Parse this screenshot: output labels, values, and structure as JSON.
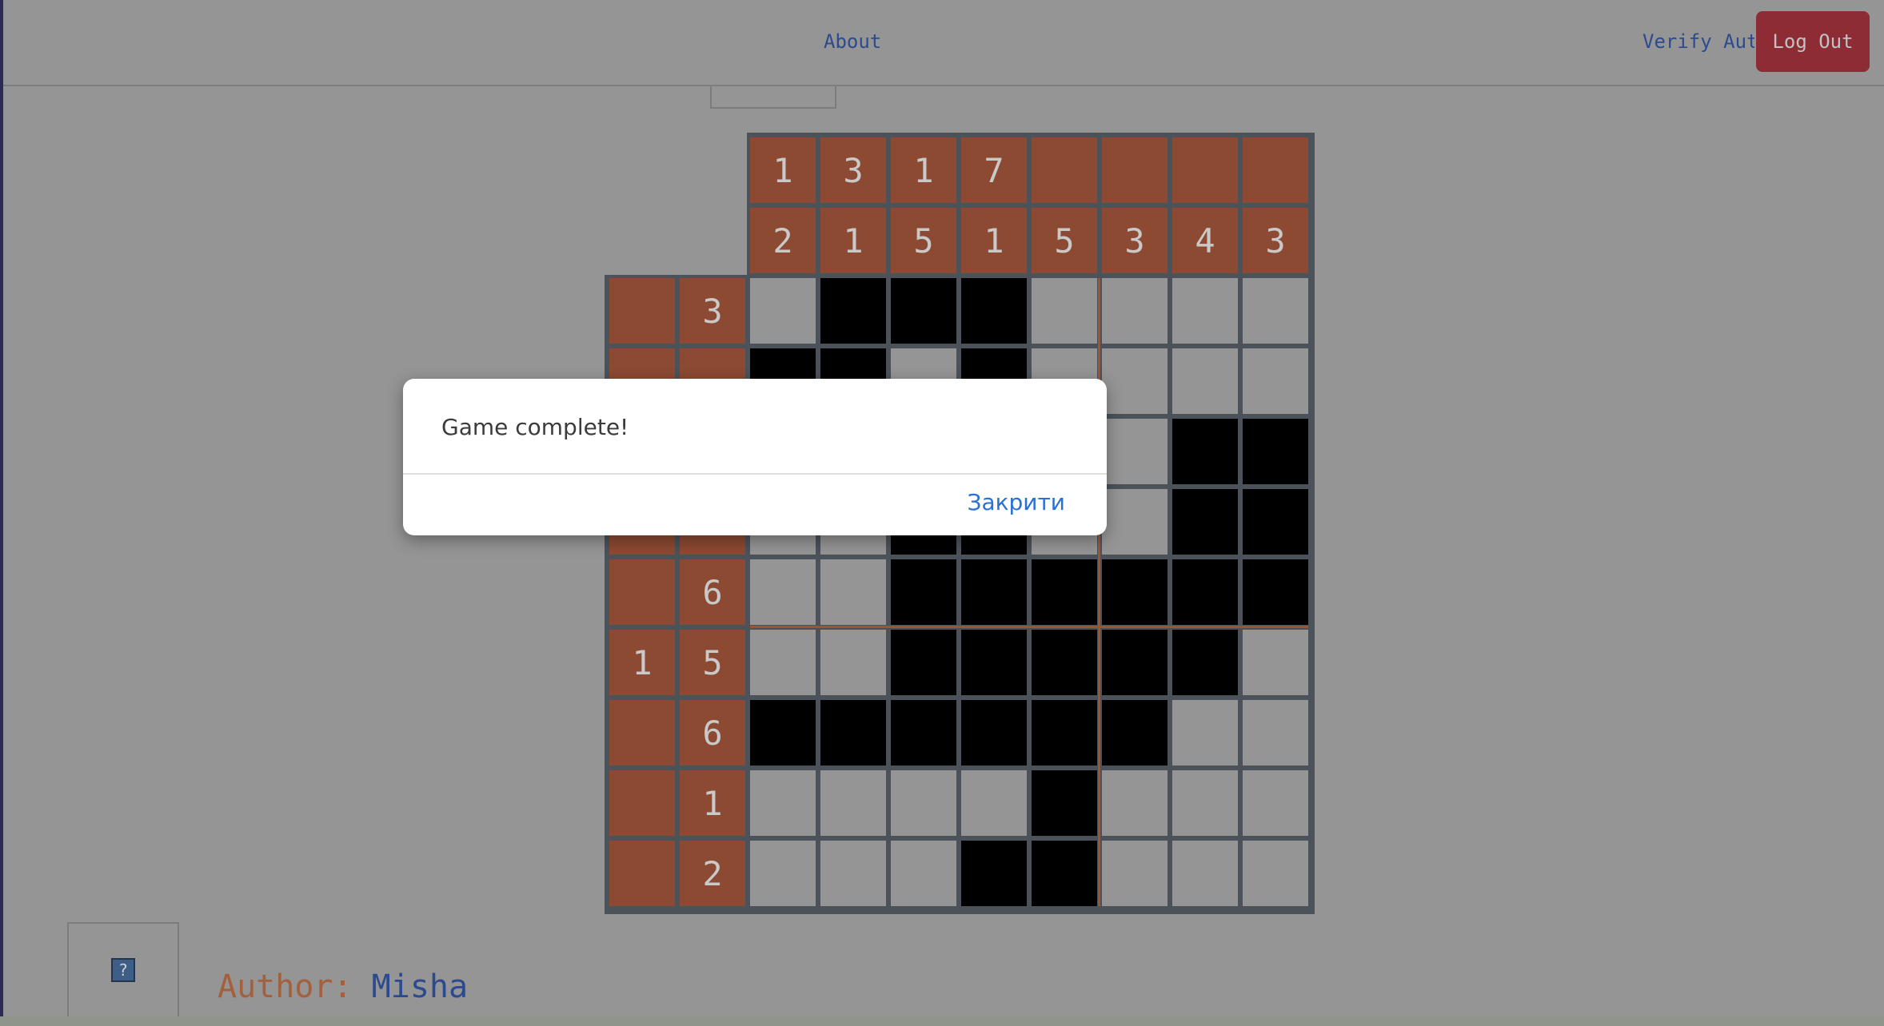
{
  "nav": {
    "about_label": "About",
    "verify_label": "Verify Auth",
    "logout_label": "Log Out"
  },
  "puzzle": {
    "rows": 9,
    "cols": 8,
    "column_clues": [
      [
        "1",
        "2"
      ],
      [
        "3",
        "1"
      ],
      [
        "1",
        "5"
      ],
      [
        "7",
        "1"
      ],
      [
        "",
        "5"
      ],
      [
        "",
        "3"
      ],
      [
        "",
        "4"
      ],
      [
        "",
        "3"
      ]
    ],
    "row_clues": [
      [
        "",
        "3"
      ],
      [
        "",
        ""
      ],
      [
        "",
        ""
      ],
      [
        "",
        ""
      ],
      [
        "",
        "6"
      ],
      [
        "1",
        "5"
      ],
      [
        "",
        "6"
      ],
      [
        "",
        "1"
      ],
      [
        "",
        "2"
      ]
    ],
    "grid": [
      [
        0,
        1,
        1,
        1,
        0,
        0,
        0,
        0
      ],
      [
        1,
        1,
        0,
        1,
        0,
        0,
        0,
        0
      ],
      [
        0,
        0,
        0,
        0,
        0,
        0,
        1,
        1
      ],
      [
        0,
        0,
        1,
        1,
        0,
        0,
        1,
        1
      ],
      [
        0,
        0,
        1,
        1,
        1,
        1,
        1,
        1
      ],
      [
        0,
        0,
        1,
        1,
        1,
        1,
        1,
        0
      ],
      [
        1,
        1,
        1,
        1,
        1,
        1,
        0,
        0
      ],
      [
        0,
        0,
        0,
        0,
        1,
        0,
        0,
        0
      ],
      [
        0,
        0,
        0,
        1,
        1,
        0,
        0,
        0
      ]
    ]
  },
  "author": {
    "label": "Author:",
    "name": "Misha"
  },
  "help": {
    "icon": "question-icon",
    "glyph": "?"
  },
  "modal": {
    "message": "Game complete!",
    "close_label": "Закрити"
  },
  "colors": {
    "clue_bg": "#8c4a32",
    "filled": "#000000",
    "blank": "#959595",
    "accent_link": "#2a6fd6",
    "logout_bg": "#8d2c35"
  }
}
